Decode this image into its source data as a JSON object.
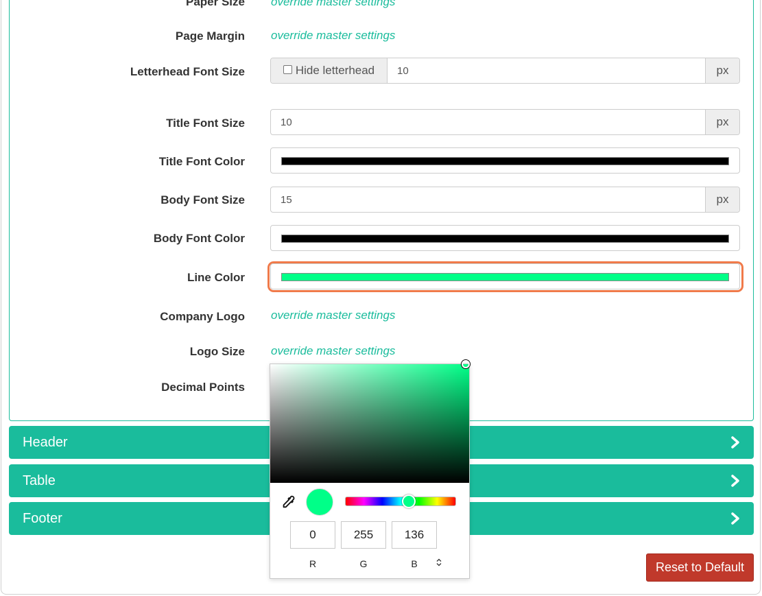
{
  "form": {
    "paper_size": {
      "label": "Paper Size",
      "link": "override master settings"
    },
    "page_margin": {
      "label": "Page Margin",
      "link": "override master settings"
    },
    "letterhead_font_size": {
      "label": "Letterhead Font Size",
      "checkbox_label": "Hide letterhead",
      "value": "10",
      "unit": "px"
    },
    "title_font_size": {
      "label": "Title Font Size",
      "value": "10",
      "unit": "px"
    },
    "title_font_color": {
      "label": "Title Font Color",
      "color": "#000000"
    },
    "body_font_size": {
      "label": "Body Font Size",
      "value": "15",
      "unit": "px"
    },
    "body_font_color": {
      "label": "Body Font Color",
      "color": "#000000"
    },
    "line_color": {
      "label": "Line Color",
      "color": "#00ff88"
    },
    "company_logo": {
      "label": "Company Logo",
      "link": "override master settings"
    },
    "logo_size": {
      "label": "Logo Size",
      "link": "override master settings"
    },
    "decimal_points": {
      "label": "Decimal Points"
    }
  },
  "sections": [
    {
      "label": "Header"
    },
    {
      "label": "Table"
    },
    {
      "label": "Footer"
    }
  ],
  "reset_button": "Reset to Default",
  "color_picker": {
    "hex": "#00ff88",
    "r": "0",
    "g": "255",
    "b": "136",
    "r_label": "R",
    "g_label": "G",
    "b_label": "B",
    "toggle_icon": "up-down-chevron-icon"
  },
  "colors": {
    "accent": "#1abc9c",
    "danger": "#c0392b",
    "focus": "#f07a4a"
  }
}
